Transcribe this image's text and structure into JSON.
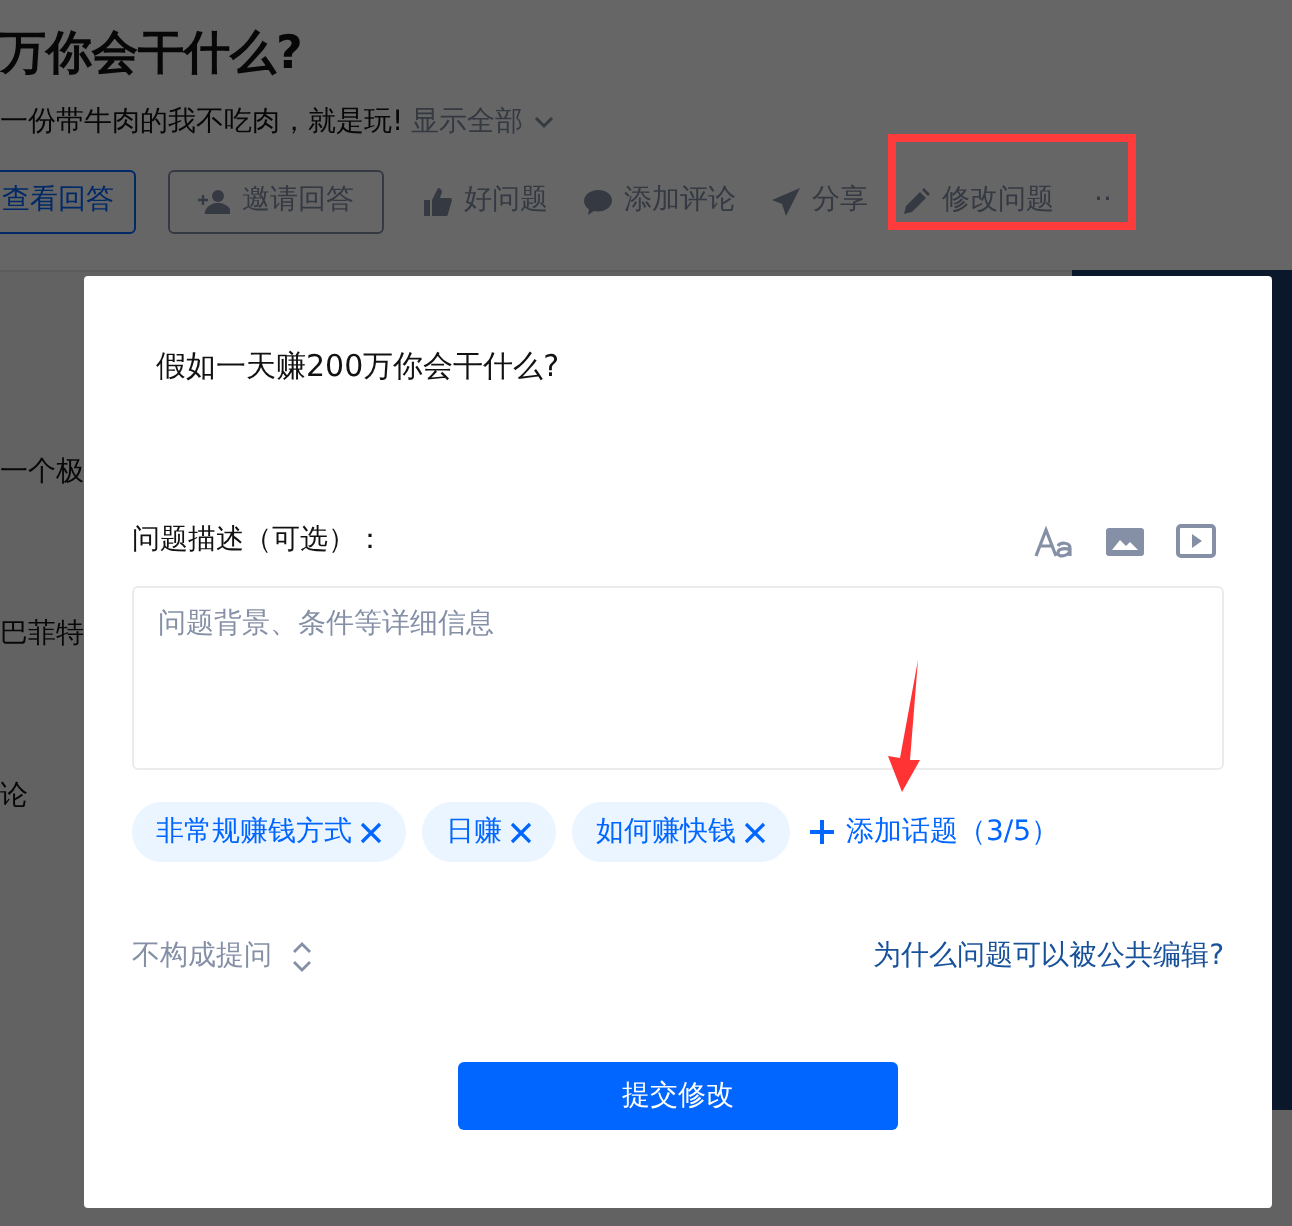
{
  "page": {
    "title": "万你会干什么?",
    "excerpt": "一份带牛肉的我不吃肉，就是玩!",
    "show_all": "显示全部",
    "actions": [
      {
        "kind": "primary",
        "label": "查看回答"
      },
      {
        "kind": "outline",
        "label": "邀请回答"
      },
      {
        "kind": "like",
        "label": "好问题"
      },
      {
        "kind": "comment",
        "label": "添加评论"
      },
      {
        "kind": "share",
        "label": "分享"
      },
      {
        "kind": "edit",
        "label": "修改问题",
        "highlighted": true
      },
      {
        "kind": "more",
        "label": "··"
      }
    ],
    "fragments": [
      "一个极",
      "巴菲特",
      "论"
    ]
  },
  "dialog": {
    "question": "假如一天赚200万你会干什么?",
    "description_label": "问题描述（可选）：",
    "description_placeholder": "问题背景、条件等详细信息",
    "topics": [
      {
        "label": "非常规赚钱方式"
      },
      {
        "label": "日赚"
      },
      {
        "label": "如何赚快钱"
      }
    ],
    "add_topic": "添加话题（3/5）",
    "reason_select": "不构成提问",
    "help_link": "为什么问题可以被公共编辑?",
    "submit": "提交修改"
  }
}
